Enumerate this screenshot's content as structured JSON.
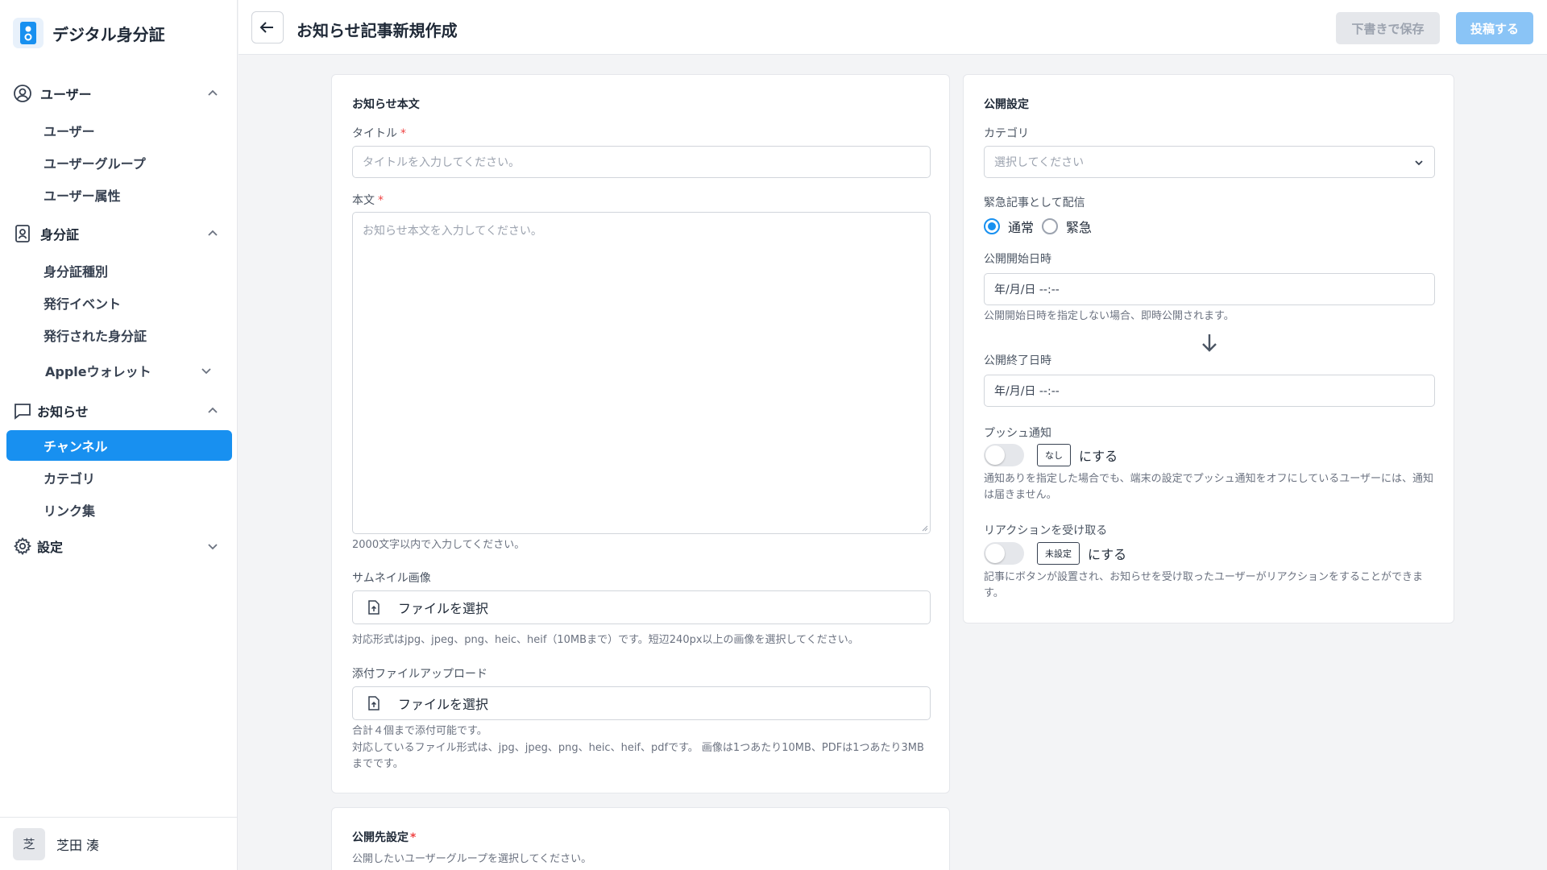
{
  "app": {
    "name": "デジタル身分証"
  },
  "sidebar": {
    "groups": [
      {
        "label": "ユーザー",
        "items": [
          "ユーザー",
          "ユーザーグループ",
          "ユーザー属性"
        ]
      },
      {
        "label": "身分証",
        "items": [
          "身分証種別",
          "発行イベント",
          "発行された身分証",
          "Appleウォレット"
        ]
      },
      {
        "label": "お知らせ",
        "items": [
          "チャンネル",
          "カテゴリ",
          "リンク集"
        ]
      },
      {
        "label": "設定",
        "items": []
      }
    ],
    "active_item": "チャンネル",
    "user": {
      "initial": "芝",
      "name": "芝田 湊"
    }
  },
  "header": {
    "title": "お知らせ記事新規作成",
    "draft_label": "下書きで保存",
    "post_label": "投稿する"
  },
  "body_card": {
    "heading": "お知らせ本文",
    "title_label": "タイトル",
    "title_placeholder": "タイトルを入力してください。",
    "body_label": "本文",
    "body_placeholder": "お知らせ本文を入力してください。",
    "body_hint": "2000文字以内で入力してください。",
    "required_mark": "*",
    "thumbnail_label": "サムネイル画像",
    "thumbnail_button": "ファイルを選択",
    "thumbnail_hint": "対応形式はjpg、jpeg、png、heic、heif（10MBまで）です。短辺240px以上の画像を選択してください。",
    "attachment_label": "添付ファイルアップロード",
    "attachment_button": "ファイルを選択",
    "attachment_hint_1": "合計４個まで添付可能です。",
    "attachment_hint_2": "対応しているファイル形式は、jpg、jpeg、png、heic、heif、pdfです。 画像は1つあたり10MB、PDFは1つあたり3MBまでです。"
  },
  "target_card": {
    "heading": "公開先設定",
    "hint": "公開したいユーザーグループを選択してください。"
  },
  "publish_card": {
    "heading": "公開設定",
    "category_label": "カテゴリ",
    "category_placeholder": "選択してください",
    "urgent_label": "緊急記事として配信",
    "radio_normal": "通常",
    "radio_urgent": "緊急",
    "radio_selected": "通常",
    "start_label": "公開開始日時",
    "start_placeholder": "年/月/日 --:--",
    "start_hint": "公開開始日時を指定しない場合、即時公開されます。",
    "end_label": "公開終了日時",
    "end_placeholder": "年/月/日 --:--",
    "push_label": "プッシュ通知",
    "push_tag": "なし",
    "push_suffix": "にする",
    "push_hint": "通知ありを指定した場合でも、端末の設定でプッシュ通知をオフにしているユーザーには、通知は届きません。",
    "push_enabled": false,
    "reaction_label": "リアクションを受け取る",
    "reaction_tag": "未設定",
    "reaction_suffix": "にする",
    "reaction_hint": "記事にボタンが設置され、お知らせを受け取ったユーザーがリアクションをすることができます。",
    "reaction_enabled": false
  },
  "colors": {
    "accent": "#1890f0",
    "required": "#ef4444",
    "post_button": "#8ac4f6",
    "draft_button": "#e5e7eb",
    "background": "#f3f4f6"
  }
}
